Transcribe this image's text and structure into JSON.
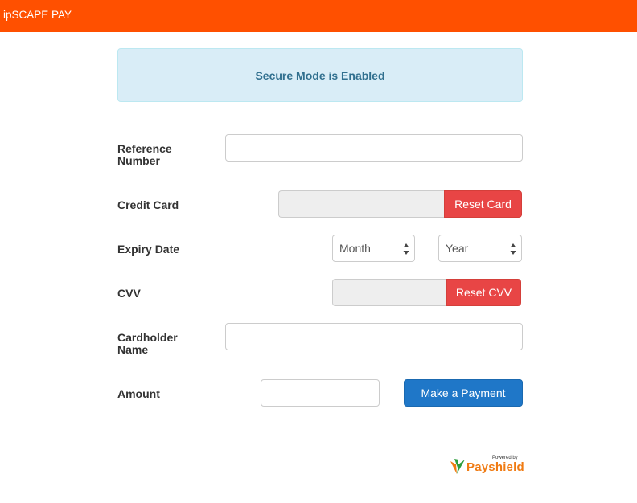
{
  "header": {
    "brand": "ipSCAPE PAY"
  },
  "alert": {
    "text": "Secure Mode is Enabled"
  },
  "form": {
    "reference": {
      "label": "Reference Number",
      "value": ""
    },
    "credit_card": {
      "label": "Credit Card",
      "value": "",
      "reset_label": "Reset Card"
    },
    "expiry": {
      "label": "Expiry Date",
      "month": "Month",
      "year": "Year"
    },
    "cvv": {
      "label": "CVV",
      "value": "",
      "reset_label": "Reset CVV"
    },
    "cardholder": {
      "label": "Cardholder Name",
      "value": ""
    },
    "amount": {
      "label": "Amount",
      "value": ""
    },
    "submit_label": "Make a Payment"
  },
  "footer": {
    "powered_by": "Powered by",
    "logo_text": "Payshield"
  },
  "colors": {
    "brand": "#ff5000",
    "danger": "#e84545",
    "primary": "#1f77c8",
    "alert_bg": "#d9edf7"
  }
}
